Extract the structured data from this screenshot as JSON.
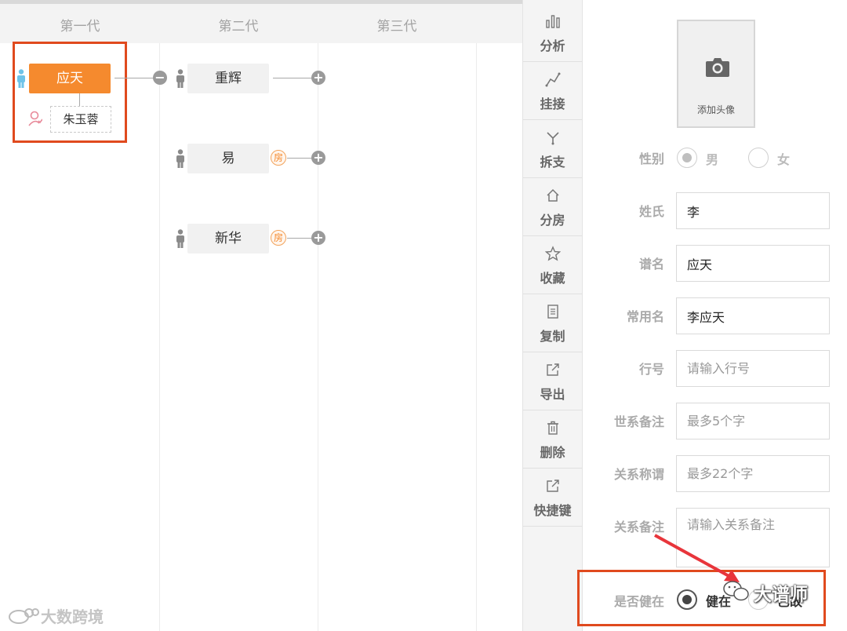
{
  "tree": {
    "generations": [
      "第一代",
      "第二代",
      "第三代"
    ],
    "root": {
      "name": "应天",
      "spouse": "朱玉蓉"
    },
    "children": [
      {
        "name": "重辉",
        "tag": ""
      },
      {
        "name": "易",
        "tag": "房"
      },
      {
        "name": "新华",
        "tag": "房"
      }
    ]
  },
  "toolbar": {
    "items": [
      {
        "label": "分析",
        "icon": "bar-chart-icon"
      },
      {
        "label": "挂接",
        "icon": "link-chain-icon"
      },
      {
        "label": "拆支",
        "icon": "split-icon"
      },
      {
        "label": "分房",
        "icon": "house-icon"
      },
      {
        "label": "收藏",
        "icon": "star-icon"
      },
      {
        "label": "复制",
        "icon": "copy-doc-icon"
      },
      {
        "label": "导出",
        "icon": "export-icon"
      },
      {
        "label": "删除",
        "icon": "trash-icon"
      },
      {
        "label": "快捷键",
        "icon": "shortcut-icon"
      }
    ]
  },
  "form": {
    "avatar_label": "添加头像",
    "gender": {
      "label": "性别",
      "options": [
        "男",
        "女"
      ],
      "selected": "男"
    },
    "surname": {
      "label": "姓氏",
      "value": "李",
      "placeholder": ""
    },
    "pedigree_name": {
      "label": "谱名",
      "value": "应天",
      "placeholder": ""
    },
    "common_name": {
      "label": "常用名",
      "value": "李应天",
      "placeholder": ""
    },
    "rank": {
      "label": "行号",
      "value": "",
      "placeholder": "请输入行号"
    },
    "lineage_note": {
      "label": "世系备注",
      "value": "",
      "placeholder": "最多5个字"
    },
    "relation_title": {
      "label": "关系称谓",
      "value": "",
      "placeholder": "最多22个字"
    },
    "relation_note": {
      "label": "关系备注",
      "value": "",
      "placeholder": "请输入关系备注"
    },
    "alive": {
      "label": "是否健在",
      "options": [
        "健在",
        "已故"
      ],
      "selected": "健在"
    }
  },
  "watermarks": {
    "left": "大数跨境",
    "right": "大谱师"
  },
  "colors": {
    "accent": "#f58a2e",
    "highlight_box": "#e04a1e",
    "annotation_arrow": "#e8353b"
  }
}
